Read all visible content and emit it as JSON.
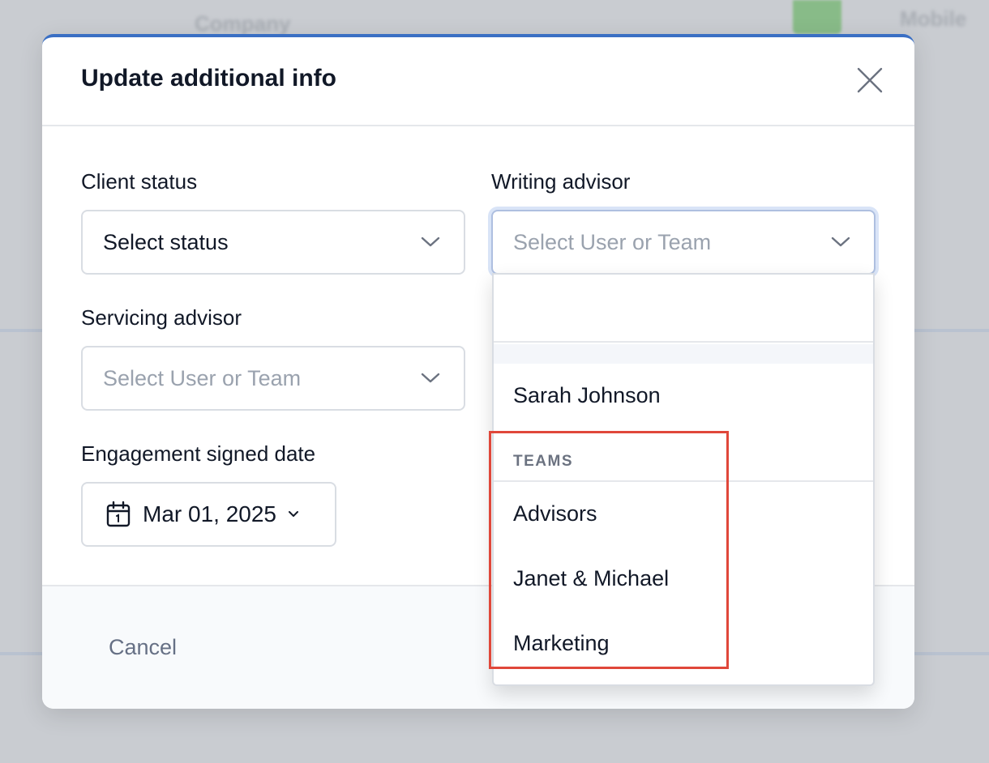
{
  "background": {
    "fragment_1": "Company",
    "fragment_2": "Mobile"
  },
  "modal": {
    "title": "Update additional info",
    "accent_color": "#3a6fc4"
  },
  "fields": {
    "client_status": {
      "label": "Client status",
      "value": "Select status"
    },
    "writing_advisor": {
      "label": "Writing advisor",
      "placeholder": "Select User or Team"
    },
    "servicing_advisor": {
      "label": "Servicing advisor",
      "placeholder": "Select User or Team"
    },
    "engagement_date": {
      "label": "Engagement signed date",
      "value": "Mar 01, 2025"
    }
  },
  "dropdown": {
    "search_value": "",
    "users": [
      "Sarah Johnson"
    ],
    "teams_header": "TEAMS",
    "teams": [
      "Advisors",
      "Janet & Michael",
      "Marketing"
    ]
  },
  "footer": {
    "cancel_label": "Cancel"
  },
  "highlight_color": "#e0473a"
}
